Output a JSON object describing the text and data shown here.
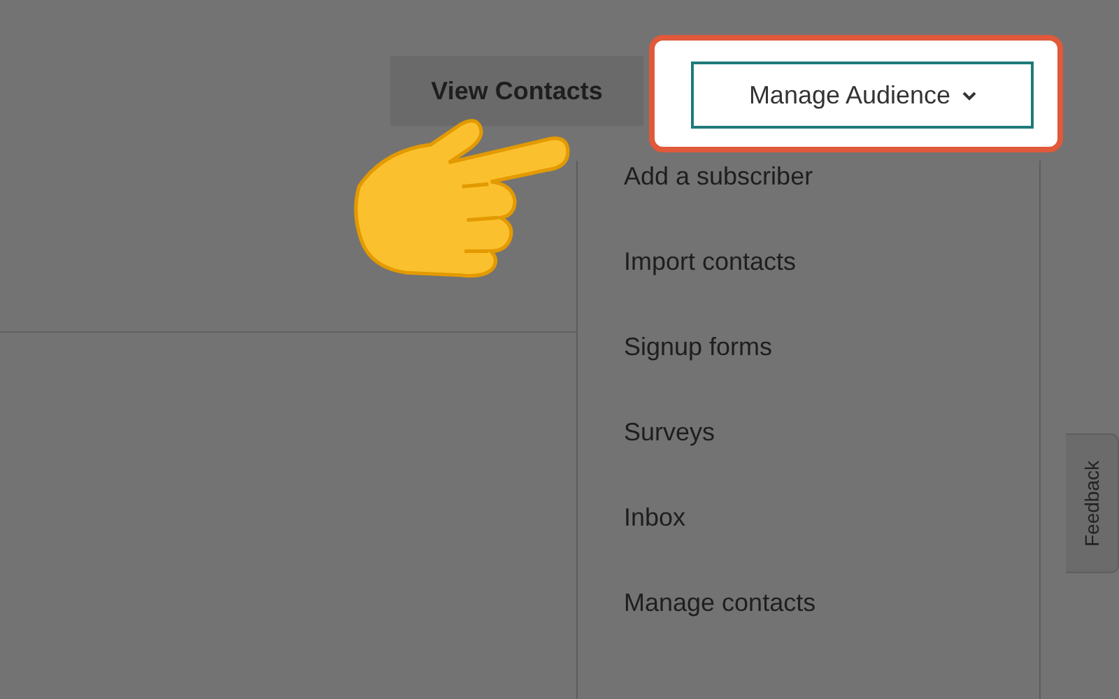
{
  "toolbar": {
    "view_contacts": "View Contacts",
    "manage_audience": {
      "label": "Manage Audience",
      "expanded": true,
      "highlighted": true
    }
  },
  "menu": {
    "items": [
      {
        "label": "Add a subscriber"
      },
      {
        "label": "Import contacts"
      },
      {
        "label": "Signup forms"
      },
      {
        "label": "Surveys"
      },
      {
        "label": "Inbox"
      },
      {
        "label": "Manage contacts"
      }
    ]
  },
  "feedback_tab": "Feedback"
}
